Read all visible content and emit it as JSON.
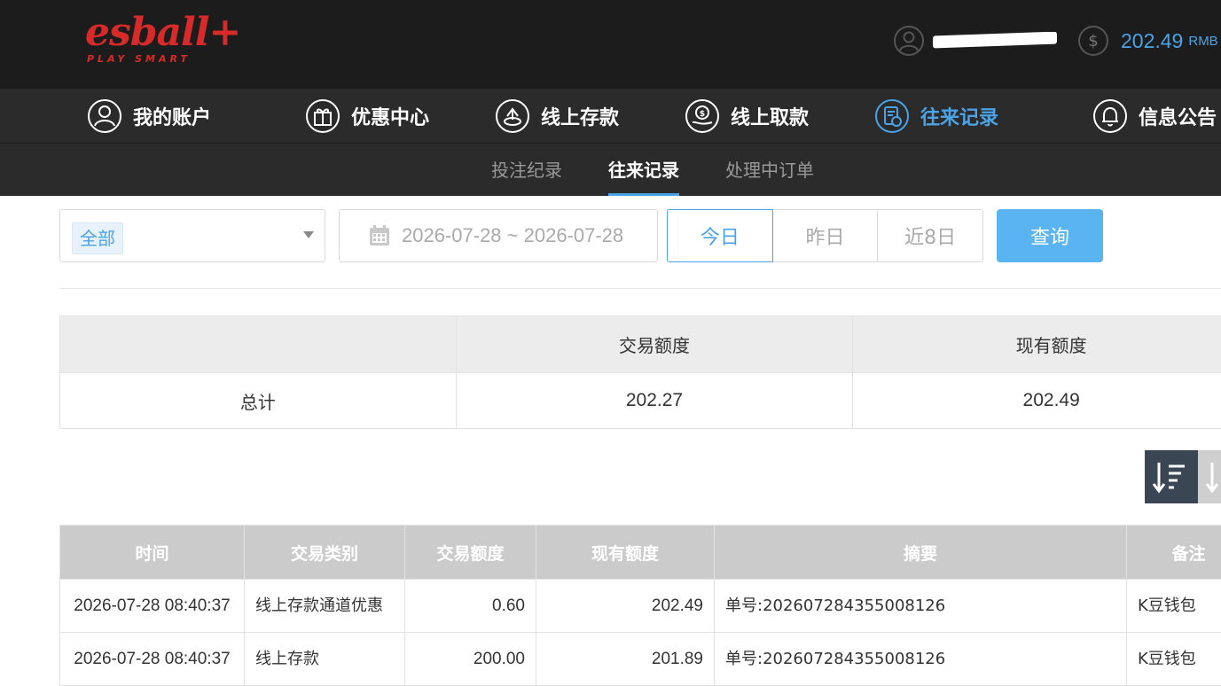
{
  "header": {
    "logo_text": "esball+",
    "logo_tagline": "PLAY SMART",
    "username": "",
    "balance": "202.49",
    "balance_unit": "RMB",
    "accent_color": "#4aa3e6",
    "logo_color": "#d72a2a"
  },
  "nav": {
    "items": [
      {
        "label": "我的账户",
        "icon": "user-icon"
      },
      {
        "label": "优惠中心",
        "icon": "gift-icon"
      },
      {
        "label": "线上存款",
        "icon": "deposit-icon"
      },
      {
        "label": "线上取款",
        "icon": "withdraw-icon"
      },
      {
        "label": "往来记录",
        "icon": "records-icon",
        "active": true
      },
      {
        "label": "信息公告",
        "icon": "bell-icon"
      }
    ]
  },
  "subnav": {
    "items": [
      {
        "label": "投注纪录"
      },
      {
        "label": "往来记录",
        "active": true
      },
      {
        "label": "处理中订单"
      }
    ]
  },
  "filters": {
    "type_selected": "全部",
    "date_range": "2026-07-28 ~ 2026-07-28",
    "range_buttons": [
      {
        "label": "今日",
        "active": true
      },
      {
        "label": "昨日"
      },
      {
        "label": "近8日"
      }
    ],
    "query_label": "查询"
  },
  "summary": {
    "headers": [
      "",
      "交易额度",
      "现有额度"
    ],
    "row": {
      "label": "总计",
      "trade_amount": "202.27",
      "current_amount": "202.49"
    }
  },
  "records": {
    "headers": [
      "时间",
      "交易类别",
      "交易额度",
      "现有额度",
      "摘要",
      "备注"
    ],
    "rows": [
      {
        "time": "2026-07-28 08:40:37",
        "type": "线上存款通道优惠",
        "amount": "0.60",
        "balance": "202.49",
        "summary": "单号:202607284355008126",
        "note": "K豆钱包"
      },
      {
        "time": "2026-07-28 08:40:37",
        "type": "线上存款",
        "amount": "200.00",
        "balance": "201.89",
        "summary": "单号:202607284355008126",
        "note": "K豆钱包"
      }
    ]
  }
}
